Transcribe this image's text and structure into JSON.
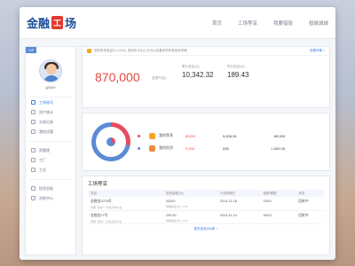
{
  "brand": {
    "logo_left": "金融",
    "logo_box": "工",
    "logo_right": "场"
  },
  "nav": {
    "items": [
      "首页",
      "工场等享",
      "我要借款",
      "投融城城"
    ]
  },
  "sidebar": {
    "vip": "VIP",
    "username": "grace",
    "items": [
      {
        "label": "工场账号",
        "active": true
      },
      {
        "label": "资产统计",
        "active": false
      },
      {
        "label": "交易记录",
        "active": false
      },
      {
        "label": "我的优惠",
        "active": false
      },
      {
        "label": "资管理",
        "active": false
      },
      {
        "label": "工厂",
        "active": false
      },
      {
        "label": "工业",
        "active": false
      },
      {
        "label": "投资总结",
        "active": false
      },
      {
        "label": "消息中心",
        "active": false
      }
    ]
  },
  "summary": {
    "notice": "您的投资收益为 0.00元, 您还有 0元以 在可以查看你的所有投资详情",
    "notice_more": "查看详情 >",
    "total_value": "870,000",
    "total_label": "总资产(元)",
    "stat1_label": "累计收益(元)",
    "stat1_value": "10,342.32",
    "stat2_label": "昨日收益(元)",
    "stat2_value": "189.43"
  },
  "assets": {
    "rows": [
      {
        "name": "我的等享",
        "amount": "89200",
        "earn": "9,006.34",
        "total": "89,000",
        "dot_color": "#e84a5f",
        "badge_color": "#f5a623"
      },
      {
        "name": "我的投资",
        "amount": "9,000",
        "earn": "535",
        "total": "1,000.26",
        "dot_color": "#5b8bd6",
        "badge_color": "#f08a3c"
      }
    ]
  },
  "table": {
    "title": "工场等享",
    "headers": [
      "项目",
      "投资金额(元)",
      "计划到期日",
      "回款/期数",
      "状态"
    ],
    "rows": [
      {
        "name": "金融金2076号",
        "sub": "到期, 借款/一次性还本付息",
        "amount": "43200",
        "amount_sub": "到期收益(元): 12%",
        "date": "2014-11-18",
        "periods": "02/01",
        "status": "回款中"
      },
      {
        "name": "金融金27号",
        "sub": "到期, 借款/一次性还本付息",
        "amount": "100.00",
        "amount_sub": "到期收益(元): 12%",
        "date": "2014-11-14",
        "periods": "06/12",
        "status": "回款中"
      }
    ],
    "more": "更多投资(54)条 >"
  }
}
